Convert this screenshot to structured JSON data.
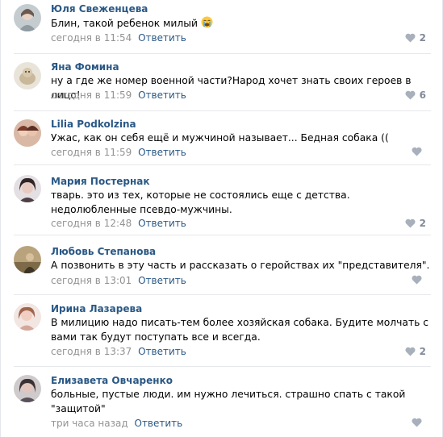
{
  "comments": [
    {
      "author": "Юля Свеженцева",
      "text": "Блин, такой ребенок милый",
      "time": "сегодня в 11:54",
      "reply": "Ответить",
      "likes": "2",
      "emoji": "tears-emoji",
      "avatar_color": "#9aa4a8"
    },
    {
      "author": "Яна Фомина",
      "text": "ну а где же номер военной части?Народ хочет знать своих героев в лицо!",
      "time": "сегодня в 11:59",
      "reply": "Ответить",
      "likes": "6",
      "avatar_color": "#c8bba4"
    },
    {
      "author": "Lilia Podkolzina",
      "text": "Ужас, как он себя ещё и мужчиной называет... Бедная собака ((",
      "time": "сегодня в 11:59",
      "reply": "Ответить",
      "likes": "",
      "avatar_color": "#b07a66"
    },
    {
      "author": "Мария Постернак",
      "text": "тварь. это из тех, которые не состоялись еще с детства. недолюбленные псевдо-мужчины.",
      "time": "сегодня в 12:48",
      "reply": "Ответить",
      "likes": "2",
      "avatar_color": "#5a4a4e"
    },
    {
      "author": "Любовь Степанова",
      "text": "А позвонить в эту часть и рассказать о геройствах их \"представителя\".",
      "time": "сегодня в 13:01",
      "reply": "Ответить",
      "likes": "",
      "avatar_color": "#8c7a5a"
    },
    {
      "author": "Ирина Лазарева",
      "text": "В милицию надо писать-тем более хозяйская собака. Будите молчать с вами так будут поступать все и всегда.",
      "time": "сегодня в 13:37",
      "reply": "Ответить",
      "likes": "2",
      "avatar_color": "#c9a39a"
    },
    {
      "author": "Елизавета Овчаренко",
      "text": "больные, пустые люди. им нужно лечиться. страшно спать с такой \"защитой\"",
      "time": "три часа назад",
      "reply": "Ответить",
      "likes": "",
      "avatar_color": "#6f6a70"
    }
  ],
  "icons": {
    "like": "heart-icon"
  },
  "colors": {
    "author": "#2a5885",
    "meta": "#939393",
    "like": "#828a99",
    "separator": "#e7e8ec"
  }
}
